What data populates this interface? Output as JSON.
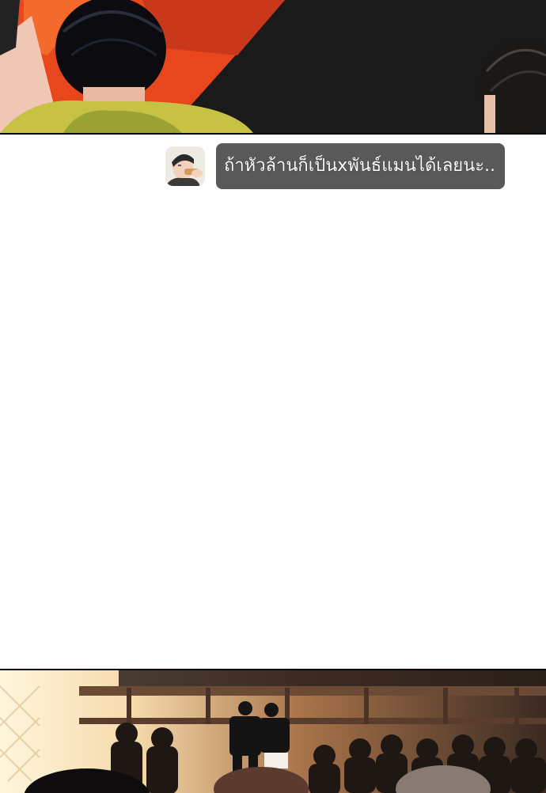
{
  "panels": {
    "top": {
      "icon": "comic-panel-image"
    },
    "bottom": {
      "icon": "comic-panel-image"
    }
  },
  "comment": {
    "avatar_icon": "user-avatar-eating",
    "text": "ถ้าหัวล้านก็เป็นxพันธ์แมนได้เลยนะ..",
    "bubble_color": "#595959",
    "text_color": "#ffffff"
  }
}
